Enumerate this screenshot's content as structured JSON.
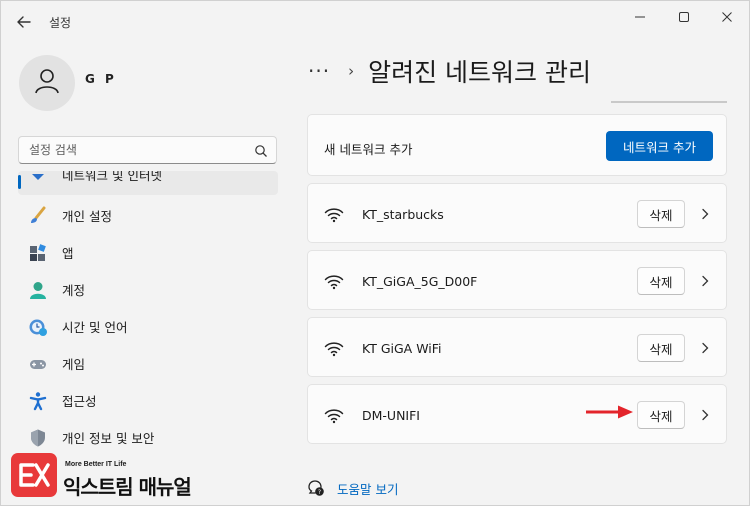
{
  "window": {
    "back_icon": "back-arrow-icon",
    "title": "설정",
    "controls": [
      "minimize-icon",
      "maximize-icon",
      "close-icon"
    ]
  },
  "user": {
    "avatar_icon": "person-icon",
    "name": "G P"
  },
  "search": {
    "placeholder": "설정 검색",
    "value": "",
    "icon": "search-icon"
  },
  "sidebar": {
    "items": [
      {
        "label": "네트워크 및 인터넷",
        "icon": "network-icon",
        "selected": true
      },
      {
        "label": "개인 설정",
        "icon": "brush-icon"
      },
      {
        "label": "앱",
        "icon": "apps-icon"
      },
      {
        "label": "계정",
        "icon": "account-icon"
      },
      {
        "label": "시간 및 언어",
        "icon": "time-language-icon"
      },
      {
        "label": "게임",
        "icon": "gamepad-icon"
      },
      {
        "label": "접근성",
        "icon": "accessibility-icon"
      },
      {
        "label": "개인 정보 및 보안",
        "icon": "shield-icon"
      }
    ]
  },
  "header": {
    "more": "···",
    "chevron": "›",
    "title": "알려진 네트워크 관리"
  },
  "add_network": {
    "label": "새 네트워크 추가",
    "button": "네트워크 추가"
  },
  "networks": [
    {
      "name": "KT_starbucks",
      "delete_label": "삭제"
    },
    {
      "name": "KT_GiGA_5G_D00F",
      "delete_label": "삭제"
    },
    {
      "name": "KT GiGA WiFi",
      "delete_label": "삭제"
    },
    {
      "name": "DM-UNIFI",
      "delete_label": "삭제"
    }
  ],
  "help": {
    "label": "도움말 보기",
    "icon": "help-icon"
  },
  "watermark": {
    "tagline": "More Better IT Life",
    "name": "익스트림 매뉴얼"
  },
  "colors": {
    "accent": "#0067c0",
    "arrow": "#e3242b",
    "watermark": "#e8393a"
  }
}
